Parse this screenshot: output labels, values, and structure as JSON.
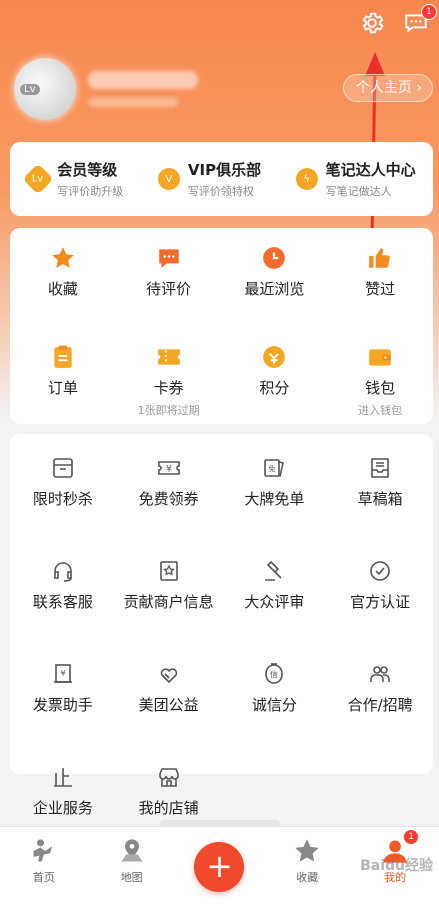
{
  "header": {
    "settings_icon": "gear-icon",
    "message_icon": "chat-icon",
    "message_badge": "1",
    "avatar_level": "Lv",
    "home_link": "个人主页"
  },
  "member_bar": [
    {
      "icon": "Lv",
      "title": "会员等级",
      "sub": "写评价助升级"
    },
    {
      "icon": "V",
      "title": "VIP俱乐部",
      "sub": "写评价领特权"
    },
    {
      "icon": "bolt",
      "title": "笔记达人中心",
      "sub": "写笔记做达人"
    }
  ],
  "grid1": [
    {
      "label": "收藏",
      "sub": ""
    },
    {
      "label": "待评价",
      "sub": ""
    },
    {
      "label": "最近浏览",
      "sub": ""
    },
    {
      "label": "赞过",
      "sub": ""
    },
    {
      "label": "订单",
      "sub": ""
    },
    {
      "label": "卡券",
      "sub": "1张即将过期"
    },
    {
      "label": "积分",
      "sub": ""
    },
    {
      "label": "钱包",
      "sub": "进入钱包"
    }
  ],
  "grid2": [
    {
      "label": "限时秒杀"
    },
    {
      "label": "免费领券"
    },
    {
      "label": "大牌免单"
    },
    {
      "label": "草稿箱"
    },
    {
      "label": "联系客服"
    },
    {
      "label": "贡献商户信息"
    },
    {
      "label": "大众评审"
    },
    {
      "label": "官方认证"
    },
    {
      "label": "发票助手"
    },
    {
      "label": "美团公益"
    },
    {
      "label": "诚信分"
    },
    {
      "label": "合作/招聘"
    },
    {
      "label": "企业服务"
    },
    {
      "label": "我的店铺"
    }
  ],
  "tabbar": {
    "home": "首页",
    "map": "地图",
    "add": "+",
    "favorites": "收藏",
    "mine": "我的",
    "mine_badge": "1"
  },
  "watermark": "Baidu经验",
  "colors": {
    "accent": "#f05a28",
    "icon_orange": "#f5a623",
    "fab": "#f1492c"
  }
}
